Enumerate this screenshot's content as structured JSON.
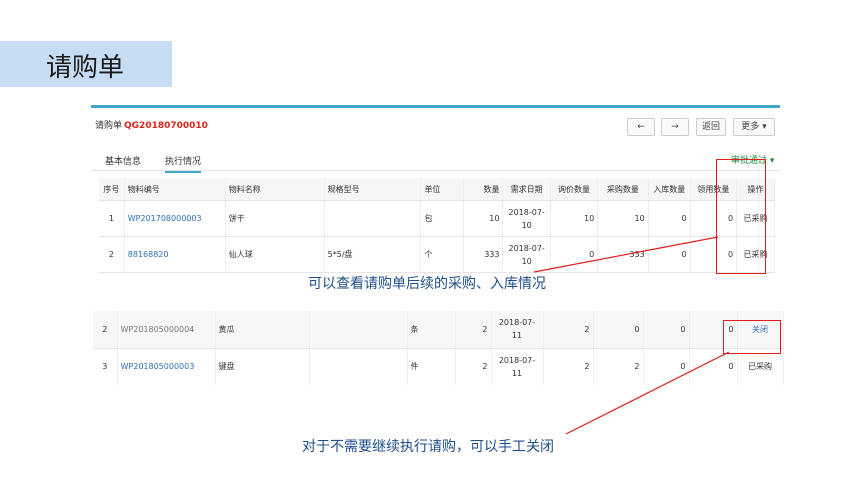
{
  "page": {
    "heading": "请购单"
  },
  "panel1": {
    "doc_label": "请购单",
    "doc_code": "QG20180700010",
    "buttons": {
      "back": "←",
      "forward": "→",
      "return": "返回",
      "more": "更多 ▾"
    },
    "tabs": [
      "基本信息",
      "执行情况"
    ],
    "approval_status": "审批通过 ▾",
    "columns": [
      "序号",
      "物料编号",
      "物料名称",
      "规格型号",
      "单位",
      "数量",
      "需求日期",
      "询价数量",
      "采购数量",
      "入库数量",
      "领用数量",
      "操作"
    ],
    "rows": [
      [
        "1",
        "WP201708000003",
        "饼干",
        "",
        "包",
        "10",
        "2018-07-10",
        "10",
        "10",
        "0",
        "0",
        "已采购"
      ],
      [
        "2",
        "88168820",
        "仙人球",
        "5*5/盘",
        "个",
        "333",
        "2018-07-10",
        "0",
        "333",
        "0",
        "0",
        "已采购"
      ]
    ]
  },
  "annotation1": "可以查看请购单后续的采购、入库情况",
  "panel2": {
    "rows": [
      [
        "2",
        "WP201805000004",
        "黄瓜",
        "",
        "条",
        "2",
        "2018-07-11",
        "2",
        "0",
        "0",
        "0",
        "关闭"
      ],
      [
        "3",
        "WP201805000003",
        "键盘",
        "",
        "件",
        "2",
        "2018-07-11",
        "2",
        "2",
        "0",
        "0",
        "已采购"
      ]
    ]
  },
  "annotation2": "对于不需要继续执行请购，可以手工关闭",
  "colors": {
    "accent": "#3fa7c9",
    "highlight": "#e02020",
    "link": "#2c6fb6",
    "approve": "#1d8d3c"
  }
}
